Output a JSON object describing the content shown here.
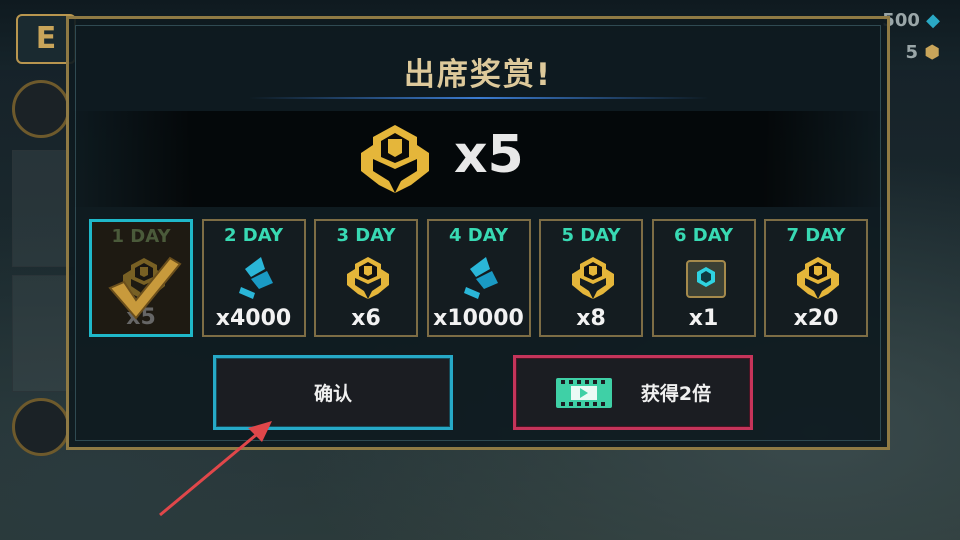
{
  "background": {
    "logo_text": "E",
    "currency_top": "500",
    "currency_bottom": "5"
  },
  "dialog": {
    "title": "出席奖赏!",
    "reward_quantity": "x5",
    "days": [
      {
        "label": "1 DAY",
        "quantity": "x5",
        "icon": "gold-shield-icon",
        "claimed": true
      },
      {
        "label": "2 DAY",
        "quantity": "x4000",
        "icon": "blue-crystal-icon",
        "claimed": false
      },
      {
        "label": "3 DAY",
        "quantity": "x6",
        "icon": "gold-shield-icon",
        "claimed": false
      },
      {
        "label": "4 DAY",
        "quantity": "x10000",
        "icon": "blue-crystal-icon",
        "claimed": false
      },
      {
        "label": "5 DAY",
        "quantity": "x8",
        "icon": "gold-shield-icon",
        "claimed": false
      },
      {
        "label": "6 DAY",
        "quantity": "x1",
        "icon": "treasure-box-icon",
        "claimed": false
      },
      {
        "label": "7 DAY",
        "quantity": "x20",
        "icon": "gold-shield-icon",
        "claimed": false
      }
    ],
    "confirm_label": "确认",
    "double_label": "获得2倍"
  },
  "colors": {
    "gold": "#e5b63a",
    "teal": "#38d9b3",
    "confirm_border": "#26a9c7",
    "double_border": "#c5345a",
    "arrow": "#e0474a"
  }
}
